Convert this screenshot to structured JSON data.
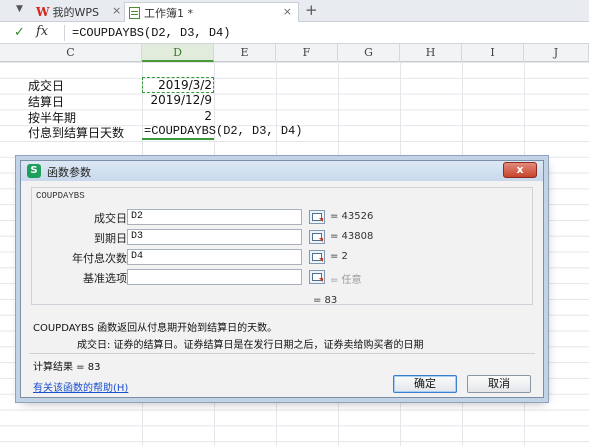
{
  "tabs": {
    "wps_logo": "W",
    "wps_label": "我的WPS",
    "book_label": "工作簿1 *",
    "close_glyph": "×",
    "new_tab_glyph": "+"
  },
  "formula_bar": {
    "fx_label": "fx",
    "formula": "=COUPDAYBS(D2, D3, D4)"
  },
  "columns": [
    "C",
    "D",
    "E",
    "F",
    "G",
    "H",
    "I",
    "J"
  ],
  "cells": {
    "c2": "成交日",
    "c3": "结算日",
    "c4": "按半年期",
    "c5": "付息到结算日天数",
    "d2": "2019/3/2",
    "d3": "2019/12/9",
    "d4": "2",
    "d5": "=COUPDAYBS(D2, D3, D4)"
  },
  "dialog": {
    "title": "函数参数",
    "icon_letter": "S",
    "close_glyph": "x",
    "function_name": "COUPDAYBS",
    "args": [
      {
        "label": "成交日",
        "value": "D2",
        "result": "= 43526"
      },
      {
        "label": "到期日",
        "value": "D3",
        "result": "= 43808"
      },
      {
        "label": "年付息次数",
        "value": "D4",
        "result": "= 2"
      },
      {
        "label": "基准选项",
        "value": "",
        "result": "= 任意"
      }
    ],
    "result_line": "= 83",
    "description": "COUPDAYBS 函数返回从付息期开始到结算日的天数。",
    "param_description": "成交日:  证券的结算日。证券结算日是在发行日期之后，证券卖给购买者的日期",
    "calc_result": "计算结果 = 83",
    "help_link": "有关该函数的帮助(H)",
    "ok_label": "确定",
    "cancel_label": "取消"
  }
}
